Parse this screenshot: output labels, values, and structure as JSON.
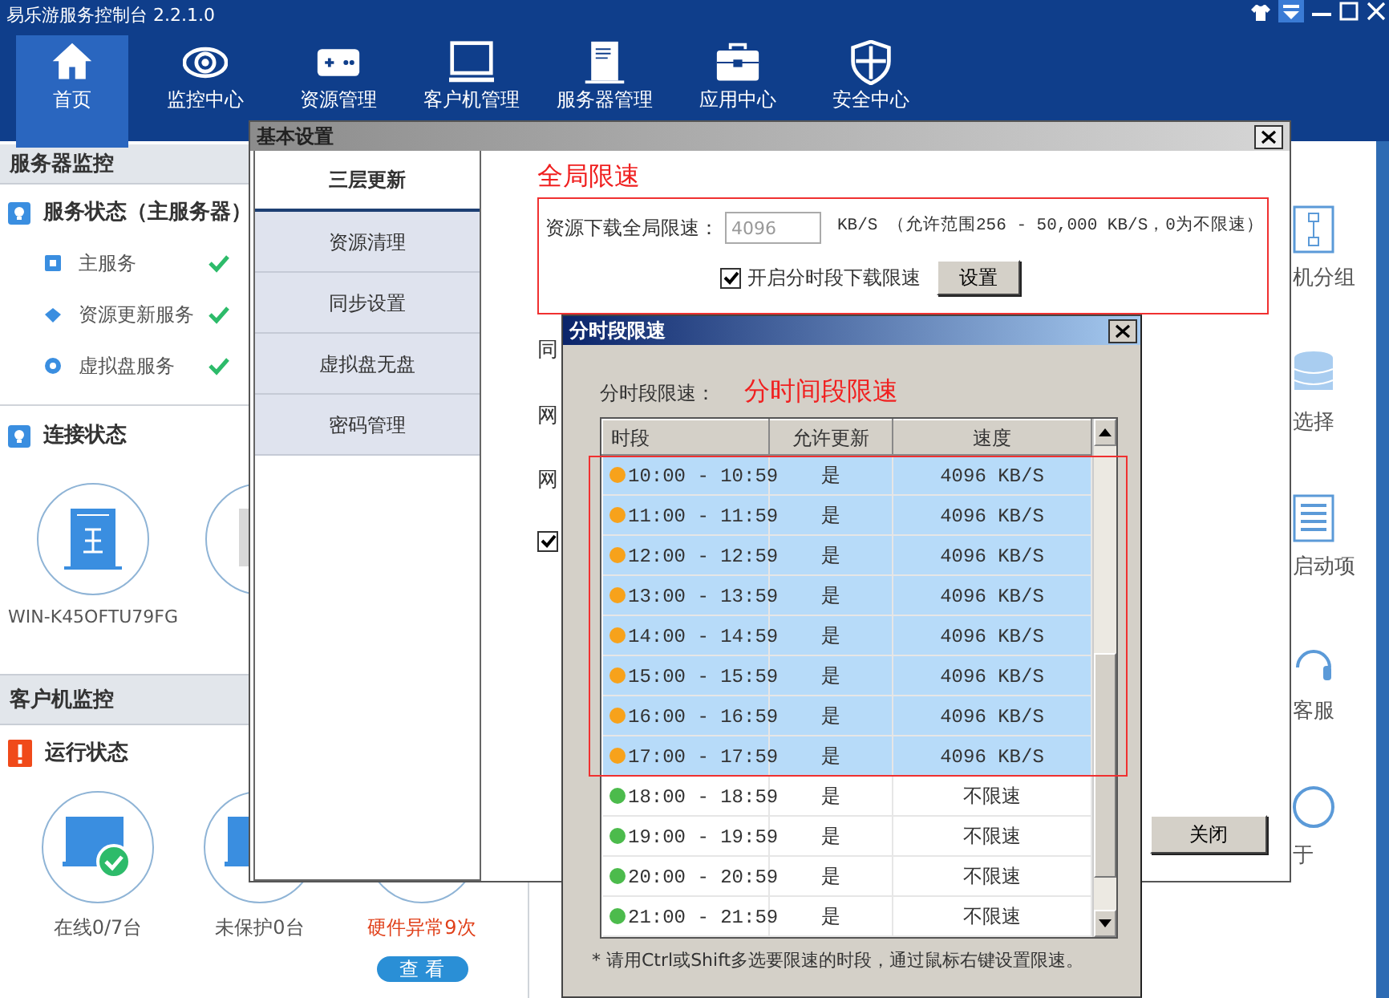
{
  "window": {
    "title": "易乐游服务控制台 2.2.1.0"
  },
  "nav": [
    {
      "label": "首页",
      "kind": "home",
      "selected": true
    },
    {
      "label": "监控中心",
      "kind": "eye",
      "selected": false
    },
    {
      "label": "资源管理",
      "kind": "gamepad",
      "selected": false
    },
    {
      "label": "客户机管理",
      "kind": "monitor",
      "selected": false
    },
    {
      "label": "服务器管理",
      "kind": "server",
      "selected": false
    },
    {
      "label": "应用中心",
      "kind": "toolbox",
      "selected": false
    },
    {
      "label": "安全中心",
      "kind": "shield",
      "selected": false
    }
  ],
  "server_monitor": {
    "title": "服务器监控",
    "service_status": {
      "title": "服务状态（主服务器）",
      "items": [
        {
          "label": "主服务",
          "kind": "square",
          "ok": true
        },
        {
          "label": "资源更新服务",
          "kind": "diamond",
          "ok": true
        },
        {
          "label": "虚拟盘服务",
          "kind": "disc",
          "ok": true
        }
      ]
    },
    "connection": {
      "title": "连接状态",
      "nodes": [
        {
          "kind": "main",
          "label": "WIN-K45OFTU79FG"
        },
        {
          "kind": "other"
        }
      ]
    }
  },
  "client_monitor": {
    "title": "客户机监控",
    "run_status": {
      "title": "运行状态",
      "stats": [
        {
          "kind": "online",
          "label": "在线0/7台",
          "alert": false
        },
        {
          "kind": "unprotected",
          "label": "未保护0台",
          "alert": false
        },
        {
          "kind": "hardware",
          "label": "硬件异常9次",
          "alert": true,
          "action": "查 看"
        }
      ]
    }
  },
  "right_panel": {
    "items": [
      {
        "kind": "group",
        "label": "机分组"
      },
      {
        "kind": "disk",
        "label": "选择"
      },
      {
        "kind": "list",
        "label": "启动项"
      },
      {
        "kind": "headset",
        "label": "客服"
      },
      {
        "kind": "info",
        "label": "于"
      }
    ]
  },
  "settings_dialog": {
    "title": "基本设置",
    "tabs": [
      {
        "label": "三层更新",
        "selected": true
      },
      {
        "label": "资源清理",
        "selected": false
      },
      {
        "label": "同步设置",
        "selected": false
      },
      {
        "label": "虚拟盘无盘",
        "selected": false
      },
      {
        "label": "密码管理",
        "selected": false
      }
    ],
    "global_limit": {
      "annotation": "全局限速",
      "label": "资源下载全局限速：",
      "value": "4096",
      "unit_note": "KB/S （允许范围256 - 50,000 KB/S，0为不限速）",
      "schedule_checkbox": {
        "label": "开启分时段下载限速",
        "checked": true
      },
      "set_button": "设置"
    },
    "partial_labels": [
      "同",
      "网",
      "网"
    ],
    "extra_checkbox": {
      "checked": true
    },
    "close_button": "关闭"
  },
  "schedule_dialog": {
    "title": "分时段限速",
    "label": "分时段限速：",
    "annotation": "分时间段限速",
    "columns": [
      "时段",
      "允许更新",
      "速度"
    ],
    "rows": [
      {
        "period": "10:00 - 10:59",
        "allow": "是",
        "speed": "4096 KB/S",
        "selected": true,
        "color": "#f7a21b"
      },
      {
        "period": "11:00 - 11:59",
        "allow": "是",
        "speed": "4096 KB/S",
        "selected": true,
        "color": "#f7a21b"
      },
      {
        "period": "12:00 - 12:59",
        "allow": "是",
        "speed": "4096 KB/S",
        "selected": true,
        "color": "#f7a21b"
      },
      {
        "period": "13:00 - 13:59",
        "allow": "是",
        "speed": "4096 KB/S",
        "selected": true,
        "color": "#f7a21b"
      },
      {
        "period": "14:00 - 14:59",
        "allow": "是",
        "speed": "4096 KB/S",
        "selected": true,
        "color": "#f7a21b"
      },
      {
        "period": "15:00 - 15:59",
        "allow": "是",
        "speed": "4096 KB/S",
        "selected": true,
        "color": "#f7a21b"
      },
      {
        "period": "16:00 - 16:59",
        "allow": "是",
        "speed": "4096 KB/S",
        "selected": true,
        "color": "#f7a21b"
      },
      {
        "period": "17:00 - 17:59",
        "allow": "是",
        "speed": "4096 KB/S",
        "selected": true,
        "color": "#f7a21b"
      },
      {
        "period": "18:00 - 18:59",
        "allow": "是",
        "speed": "不限速",
        "selected": false,
        "color": "#4cbb4c"
      },
      {
        "period": "19:00 - 19:59",
        "allow": "是",
        "speed": "不限速",
        "selected": false,
        "color": "#4cbb4c"
      },
      {
        "period": "20:00 - 20:59",
        "allow": "是",
        "speed": "不限速",
        "selected": false,
        "color": "#4cbb4c"
      },
      {
        "period": "21:00 - 21:59",
        "allow": "是",
        "speed": "不限速",
        "selected": false,
        "color": "#4cbb4c"
      }
    ],
    "note": "* 请用Ctrl或Shift多选要限速的时段，通过鼠标右键设置限速。"
  }
}
